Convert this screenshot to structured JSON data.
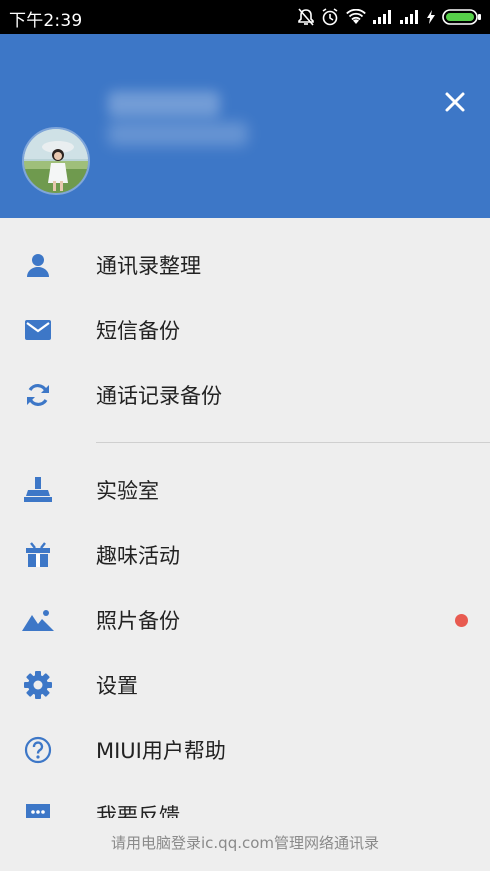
{
  "status_bar": {
    "time": "下午2:39",
    "icons": [
      "mute-icon",
      "alarm-icon",
      "wifi-icon",
      "signal-icon",
      "signal-icon",
      "charging-icon",
      "battery-icon"
    ]
  },
  "header": {
    "background": "#3d77c7",
    "close_icon": "close-icon"
  },
  "menu": {
    "accent": "#3d77c7",
    "items": [
      {
        "label": "通讯录整理",
        "icon": "person-icon"
      },
      {
        "label": "短信备份",
        "icon": "mail-icon"
      },
      {
        "label": "通话记录备份",
        "icon": "sync-icon"
      },
      {
        "label": "实验室",
        "icon": "lab-icon"
      },
      {
        "label": "趣味活动",
        "icon": "gift-icon"
      },
      {
        "label": "照片备份",
        "icon": "photo-icon",
        "badge_dot": true,
        "badge_color": "#e85a50"
      },
      {
        "label": "设置",
        "icon": "gear-icon"
      },
      {
        "label": "MIUI用户帮助",
        "icon": "help-icon"
      },
      {
        "label": "我要反馈",
        "icon": "feedback-icon"
      }
    ]
  },
  "footer": {
    "hint": "请用电脑登录ic.qq.com管理网络通讯录"
  }
}
